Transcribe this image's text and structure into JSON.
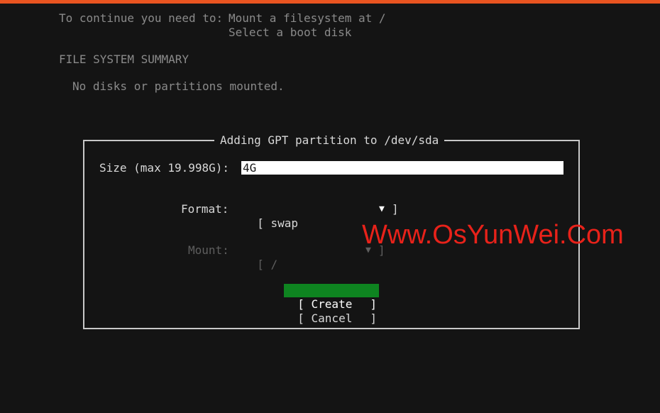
{
  "header": {
    "continue_label": "To continue you need to:",
    "requirement_1": "Mount a filesystem at /",
    "requirement_2": "Select a boot disk"
  },
  "summary": {
    "title": "FILE SYSTEM SUMMARY",
    "empty_message": "No disks or partitions mounted."
  },
  "dialog": {
    "title": "Adding GPT partition to /dev/sda",
    "size_label": "Size (max 19.998G):",
    "size_value": "4G",
    "format_label": "Format:",
    "format_value": "swap",
    "mount_label": "Mount:",
    "mount_value": "/",
    "create_button": "Create",
    "cancel_button": "Cancel"
  },
  "watermark": "Www.OsYunWei.Com",
  "colors": {
    "accent": "#e95420",
    "selected_button": "#0e8420",
    "background": "#141414",
    "watermark": "#e8221a"
  }
}
